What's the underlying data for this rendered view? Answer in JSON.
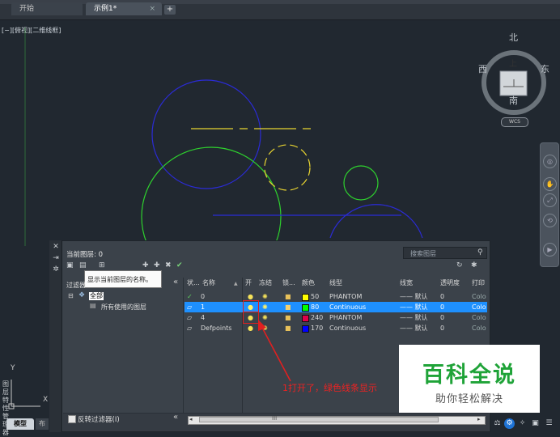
{
  "tabs": [
    {
      "label": "开始",
      "active": false
    },
    {
      "label": "示例1*",
      "active": true
    }
  ],
  "tab_close": "×",
  "new_tab": "+",
  "viewport_label": "[−][俯视][二维线框]",
  "viewcube": {
    "north": "北",
    "south": "南",
    "east": "东",
    "west": "西",
    "face": "上",
    "wcs": "WCS"
  },
  "ucs": {
    "y": "Y",
    "x": "X"
  },
  "layer_palette": {
    "current_layer": "当前图层: 0",
    "search_placeholder": "搜索图层",
    "tooltip": "显示当前图层的名称。",
    "filter_label": "过滤器",
    "collapse": "«",
    "tree_all": "全部",
    "tree_used": "所有使用的图层",
    "invert_filter": "反转过滤器(I)",
    "strip_title": "图层特性管理器",
    "columns": [
      "状...",
      "名称",
      "开",
      "冻结",
      "锁...",
      "颜色",
      "线型",
      "线宽",
      "透明度",
      "打印"
    ],
    "rows": [
      {
        "name": "0",
        "color_no": "50",
        "color_hex": "#ffff00",
        "linetype": "PHANTOM",
        "lineweight": "—— 默认",
        "transparency": "0",
        "plot": "Colo",
        "selected": false
      },
      {
        "name": "1",
        "color_no": "80",
        "color_hex": "#00ff00",
        "linetype": "Continuous",
        "lineweight": "—— 默认",
        "transparency": "0",
        "plot": "Colo",
        "selected": true
      },
      {
        "name": "4",
        "color_no": "240",
        "color_hex": "#e0004a",
        "linetype": "PHANTOM",
        "lineweight": "—— 默认",
        "transparency": "0",
        "plot": "Colo",
        "selected": false
      },
      {
        "name": "Defpoints",
        "color_no": "170",
        "color_hex": "#0000ff",
        "linetype": "Continuous",
        "lineweight": "—— 默认",
        "transparency": "0",
        "plot": "Colo",
        "selected": false
      }
    ],
    "scroll_mark": "III"
  },
  "annotation": "1打开了，绿色线条显示",
  "watermark": {
    "title": "百科全说",
    "subtitle": "助你轻松解决"
  },
  "model_tab": "模型",
  "layout_tab": "布",
  "colors": {
    "selection": "#1e90ff",
    "annotation": "#e02020",
    "brand_green": "#1fa338"
  }
}
